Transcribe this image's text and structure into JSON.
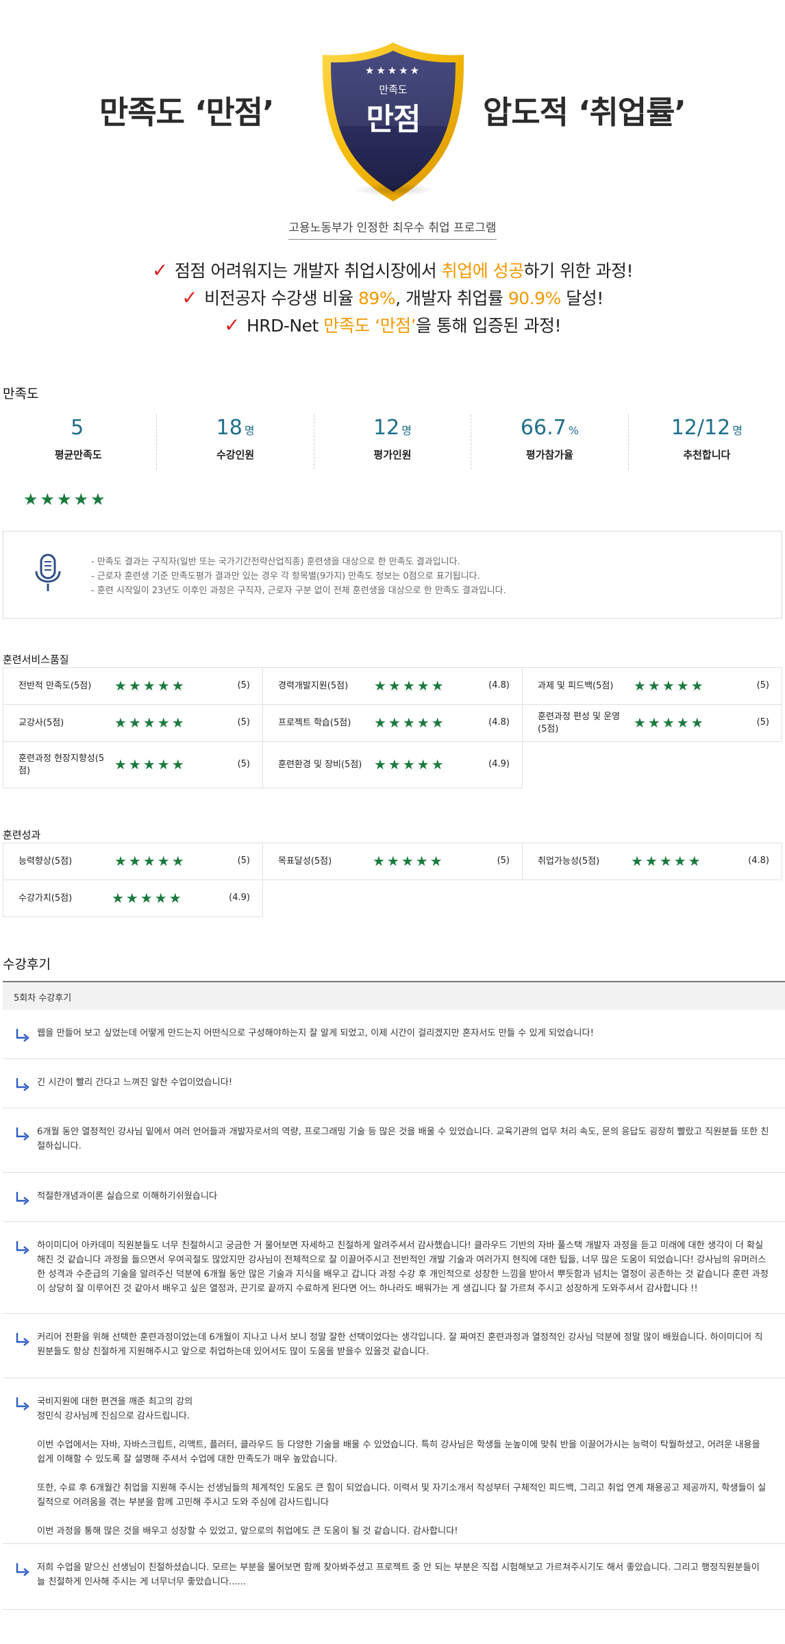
{
  "hero": {
    "left_title": "만족도 ‘만점’",
    "right_title": "압도적 ‘취업률’",
    "badge_top": "만족도",
    "badge_main": "만점",
    "badge_stars": "★★★★★",
    "ministry": "고용노동부가 인정한 최우수 취업 프로그램",
    "check_mark": "✓",
    "checks": [
      {
        "a": "점점 어려워지는 개발자 취업시장에서 ",
        "b": "취업에 성공",
        "c": "하기 위한 과정!"
      },
      {
        "a": "비전공자 수강생 비율 ",
        "b": "89%",
        "c": ", 개발자 취업률 ",
        "d": "90.9%",
        "e": " 달성!"
      },
      {
        "a": "HRD-Net ",
        "b": "만족도 ‘만점’",
        "c": "을 통해 입증된 과정!"
      }
    ],
    "colors": {
      "accent": "#f39800",
      "check": "#d92121",
      "badge_navy": "#2a2d5c",
      "badge_gold": "#f2b705"
    }
  },
  "satisfaction": {
    "title": "만족도",
    "stats": [
      {
        "value": "5",
        "unit": "",
        "label": "평균만족도"
      },
      {
        "value": "18",
        "unit": "명",
        "label": "수강인원"
      },
      {
        "value": "12",
        "unit": "명",
        "label": "평가인원"
      },
      {
        "value": "66.7",
        "unit": "%",
        "label": "평가참가율"
      },
      {
        "value": "12/12",
        "unit": "명",
        "label": "추천합니다"
      }
    ],
    "stars": "★★★★★",
    "star_color": "#1b7a3e",
    "notice_icon": "microphone-icon",
    "notices": [
      "- 만족도 결과는 구직자(일반 또는 국가기간전략산업직종) 훈련생을 대상으로 한 만족도 결과입니다.",
      "- 근로자 훈련생 기준 만족도평가 결과만 있는 경우 각 항목별(9가지) 만족도 정보는 0점으로 표기됩니다.",
      "- 훈련 시작일이 23년도 이후인 과정은 구직자, 근로자 구분 없이 전체 훈련생을 대상으로 한 만족도 결과입니다."
    ]
  },
  "service_quality": {
    "title": "훈련서비스품질",
    "items": [
      {
        "label": "전반적 만족도(5점)",
        "score": "(5)"
      },
      {
        "label": "경력개발지원(5점)",
        "score": "(4.8)"
      },
      {
        "label": "과제 및 피드백(5점)",
        "score": "(5)"
      },
      {
        "label": "교강사(5점)",
        "score": "(5)"
      },
      {
        "label": "프로젝트 학습(5점)",
        "score": "(4.8)"
      },
      {
        "label": "훈련과정 편성 및 운영(5점)",
        "score": "(5)"
      },
      {
        "label": "훈련과정 현장지향성(5점)",
        "score": "(5)"
      },
      {
        "label": "훈련환경 및 장비(5점)",
        "score": "(4.9)"
      }
    ]
  },
  "outcomes": {
    "title": "훈련성과",
    "items": [
      {
        "label": "능력향상(5점)",
        "score": "(5)"
      },
      {
        "label": "목표달성(5점)",
        "score": "(5)"
      },
      {
        "label": "취업가능성(5점)",
        "score": "(4.8)"
      },
      {
        "label": "수강가치(5점)",
        "score": "(4.9)"
      }
    ]
  },
  "reviews": {
    "title": "수강후기",
    "round_label": "5회차 수강후기",
    "arrow_icon": "reply-arrow-icon",
    "items": [
      {
        "paras": [
          "웹을 만들어 보고 싶었는데 어떻게 만드는지 어떤식으로 구성해야하는지 잘 알게 되었고, 이제 시간이 걸리겠지만 혼자서도 만들 수 있게 되었습니다!"
        ]
      },
      {
        "paras": [
          "긴 시간이 빨리 간다고 느껴진 알찬 수업이었습니다!"
        ]
      },
      {
        "paras": [
          "6개월 동안 열정적인 강사님 밑에서 여러 언어들과 개발자로서의 역량, 프로그래밍 기술 등 많은 것을 배울 수 있었습니다. 교육기관의 업무 처리 속도, 문의 응답도 굉장히 빨랐고 직원분들 또한 친절하십니다."
        ]
      },
      {
        "paras": [
          "적절한개념과이론  실습으로  이해하기쉬웠습니다"
        ]
      },
      {
        "paras": [
          "하이미디어 아카데미 직원분들도 너무 친절하시고 궁금한 거 물어보면 자세하고 친절하게 알려주셔서 감사했습니다! 클라우드 기반의 자바 풀스택 개발자 과정을 듣고 미래에 대한 생각이 더 확실해진 것 같습니다 과정을 들으면서 우여곡절도 많았지만 강사님이 전체적으로 잘 이끌어주시고 전반적인 개발 기술과 여러가지 현직에 대한 팁들, 너무 많은 도움이 되었습니다! 강사님의 유머러스한 성격과 수준급의 기술을 알려주신 덕분에 6개월 동안 많은 기술과 지식을 배우고 갑니다 과정 수강 후 개인적으로 성장한 느낌을 받아서 뿌듯함과 넘치는 열정이 공존하는 것 같습니다 훈련 과정이 상당히 잘 이루어진 것 같아서 배우고 싶은 열정과, 끈기로 끝까지 수료하게 된다면 어느 하나라도 배워가는 게 생깁니다 잘 가르쳐 주시고 성장하게 도와주셔서 감사합니다 !!"
        ]
      },
      {
        "paras": [
          "커리어 전환을 위해 선택한 훈련과정이었는데 6개월이 지나고 나서 보니 정말 잘한 선택이었다는 생각입니다. 잘 짜여진 훈련과정과 열정적인 강사님 덕분에 정말 많이 배웠습니다. 하이미디어 직원분들도 항상 친절하게 지원해주시고 앞으로 취업하는데 있어서도 많이 도움을 받을수 있을것 같습니다."
        ]
      },
      {
        "paras": [
          "국비지원에 대한 편견을 깨준 최고의 강의",
          "정민식 강사님께 진심으로 감사드립니다.",
          "",
          "이번 수업에서는 자바, 자바스크립트, 리액트, 플러터, 클라우드 등 다양한 기술을 배울 수 있었습니다. 특히 강사님은 학생들 눈높이에 맞춰 반을 이끌어가시는 능력이 탁월하셨고, 어려운 내용을 쉽게 이해할 수 있도록 잘 설명해 주셔서 수업에 대한 만족도가 매우 높았습니다.",
          "",
          "또한, 수료 후 6개월간 취업을 지원해 주시는 선생님들의 체계적인 도움도 큰 힘이 되었습니다. 이력서 및 자기소개서 작성부터 구체적인 피드백, 그리고 취업 연계 채용공고 제공까지, 학생들이 실질적으로 어려움을 겪는 부분을 함께 고민해 주시고 도와 주심에 감사드립니다",
          "",
          "이번 과정을 통해 많은 것을 배우고 성장할 수 있었고, 앞으로의 취업에도 큰 도움이 될 것 같습니다. 감사합니다!"
        ]
      },
      {
        "paras": [
          "저희 수업을 맡으신 선생님이 친절하셨습니다. 모르는 부분을 물어보면 함께 찾아봐주셨고 프로젝트 중 안 되는 부분은 직접 시험해보고 가르쳐주시기도 해서 좋았습니다. 그리고 행정직원분들이 늘 친절하게 인사해 주시는 게 너무너무 좋았습니다......"
        ]
      }
    ]
  }
}
